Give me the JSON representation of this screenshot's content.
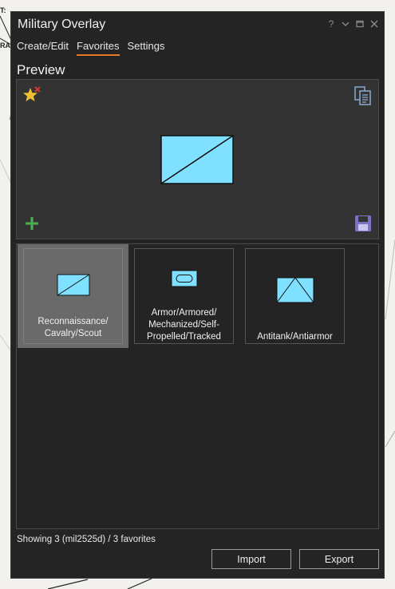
{
  "window": {
    "title": "Military Overlay"
  },
  "tabs": [
    {
      "label": "Create/Edit",
      "active": false
    },
    {
      "label": "Favorites",
      "active": true
    },
    {
      "label": "Settings",
      "active": false
    }
  ],
  "preview": {
    "heading": "Preview"
  },
  "favorites": [
    {
      "label_lines": [
        "Reconnaissance/",
        "Cavalry/Scout"
      ],
      "symbol": "reconnaissance",
      "selected": true
    },
    {
      "label_lines": [
        "Armor/Armored/",
        "Mechanized/Self-",
        "Propelled/Tracked"
      ],
      "symbol": "armor",
      "selected": false
    },
    {
      "label_lines": [
        "Antitank/Antiarmor"
      ],
      "symbol": "antitank",
      "selected": false
    }
  ],
  "status": {
    "text": "Showing 3 (mil2525d) / 3 favorites"
  },
  "buttons": {
    "import_label": "Import",
    "export_label": "Export"
  },
  "map_labels": [
    "T:",
    "RA"
  ],
  "colors": {
    "symbol_fill": "#80e0ff",
    "tab_underline": "#e8772e",
    "star": "#f0c030",
    "add": "#4caf50",
    "save": "#7a73c8"
  }
}
